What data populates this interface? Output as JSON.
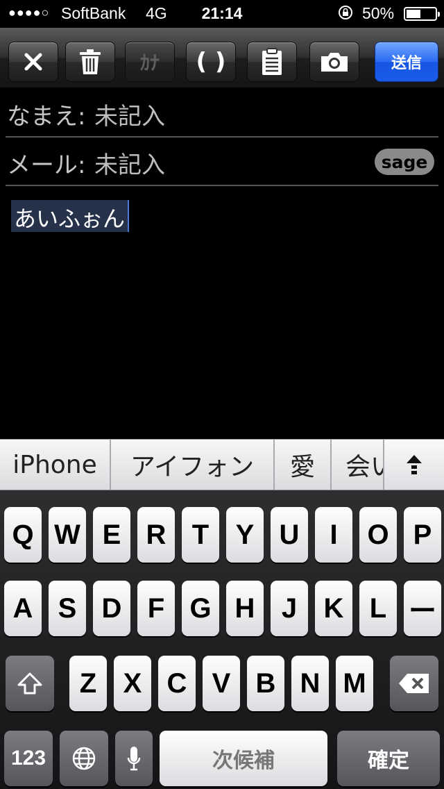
{
  "status_bar": {
    "signal": "●●●●○",
    "carrier": "SoftBank",
    "network": "4G",
    "time": "21:14",
    "battery_percent": "50%",
    "battery_level": 0.5
  },
  "toolbar": {
    "close_icon": "close-icon",
    "trash_icon": "trash-icon",
    "kana_label": "ｶﾅ",
    "paren_label": "( )",
    "clipboard_icon": "clipboard-icon",
    "camera_icon": "camera-icon",
    "send_label": "送信",
    "accent_color": "#2a6af1"
  },
  "form": {
    "name_label": "なまえ:",
    "name_value": "未記入",
    "mail_label": "メール:",
    "mail_value": "未記入",
    "sage_label": "sage",
    "body_value": "あいふぉん"
  },
  "candidates": {
    "items": [
      "iPhone",
      "アイフォン",
      "愛",
      "会い"
    ],
    "more_icon": "up-arrow-icon"
  },
  "keyboard": {
    "row1": [
      "Q",
      "W",
      "E",
      "R",
      "T",
      "Y",
      "U",
      "I",
      "O",
      "P"
    ],
    "row2": [
      "A",
      "S",
      "D",
      "F",
      "G",
      "H",
      "J",
      "K",
      "L",
      "ー"
    ],
    "row3": [
      "Z",
      "X",
      "C",
      "V",
      "B",
      "N",
      "M"
    ],
    "numbers_label": "123",
    "space_label": "次候補",
    "return_label": "確定"
  }
}
